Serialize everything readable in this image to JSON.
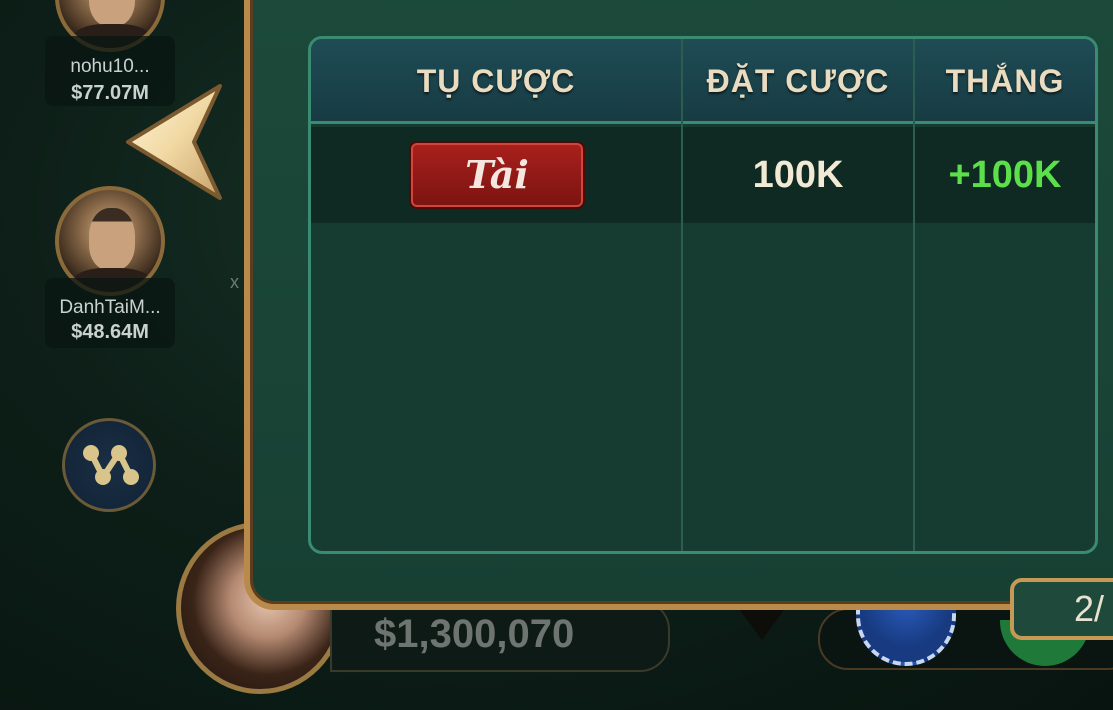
{
  "players": [
    {
      "name": "nohu10...",
      "money": "$77.07M"
    },
    {
      "name": "DanhTaiM...",
      "money": "$48.64M"
    }
  ],
  "history_table": {
    "columns": [
      "TỤ CƯỢC",
      "ĐẶT CƯỢC",
      "THẮNG"
    ],
    "rows": [
      {
        "side": "Tài",
        "bet": "100K",
        "win": "+100K"
      }
    ]
  },
  "balance": "$1,300,070",
  "page_indicator": "2/",
  "icons": [
    "back-arrow-icon",
    "scoreboard-icon"
  ],
  "colors": {
    "accent_gold": "#c69a56",
    "win_green": "#5ce04a",
    "tai_red": "#a8201c"
  }
}
